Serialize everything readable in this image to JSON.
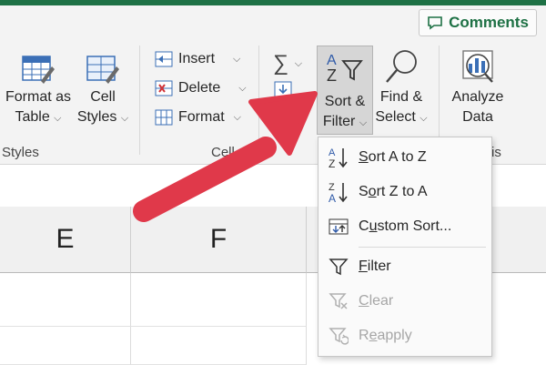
{
  "ribbon": {
    "comments_label": "Comments",
    "styles_group": {
      "format_as_table_line1": "Format as",
      "format_as_table_line2": "Table",
      "cell_styles_line1": "Cell",
      "cell_styles_line2": "Styles",
      "group_label": "Styles"
    },
    "cells_group": {
      "insert_label": "Insert",
      "delete_label": "Delete",
      "format_label": "Format",
      "group_label": "Cell"
    },
    "editing_group": {
      "sort_filter_line1": "Sort &",
      "sort_filter_line2": "Filter",
      "find_select_line1": "Find &",
      "find_select_line2": "Select",
      "group_label_partial": "is"
    },
    "analysis_group": {
      "analyze_data_line1": "Analyze",
      "analyze_data_line2": "Data"
    }
  },
  "sheet": {
    "columns": [
      "E",
      "F"
    ]
  },
  "sort_menu": {
    "items": [
      {
        "pre": "",
        "ul": "S",
        "post": "ort A to Z",
        "icon": "sort-ascending-icon",
        "enabled": true
      },
      {
        "pre": "S",
        "ul": "o",
        "post": "rt Z to A",
        "icon": "sort-descending-icon",
        "enabled": true
      },
      {
        "pre": "C",
        "ul": "u",
        "post": "stom Sort...",
        "icon": "custom-sort-icon",
        "enabled": true
      },
      {
        "pre": "",
        "ul": "F",
        "post": "ilter",
        "icon": "filter-icon",
        "enabled": true
      },
      {
        "pre": "",
        "ul": "C",
        "post": "lear",
        "icon": "clear-filter-icon",
        "enabled": false
      },
      {
        "pre": "R",
        "ul": "e",
        "post": "apply",
        "icon": "reapply-icon",
        "enabled": false
      }
    ]
  },
  "colors": {
    "accent_green": "#1e7145",
    "arrow_red": "#e0394a"
  }
}
